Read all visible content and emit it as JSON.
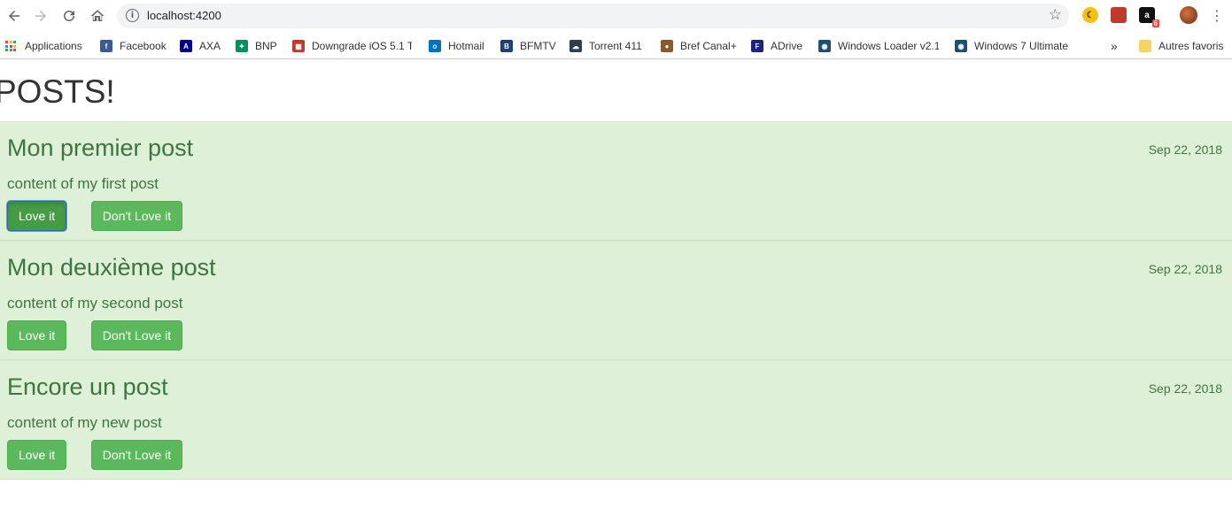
{
  "browser": {
    "url": "localhost:4200",
    "bookmarks": [
      {
        "label": "Applications",
        "icon": "apps-grid-icon"
      },
      {
        "label": "Facebook",
        "icon": "facebook-icon",
        "color": "#3b5998"
      },
      {
        "label": "AXA",
        "icon": "axa-icon",
        "color": "#00008f"
      },
      {
        "label": "BNP",
        "icon": "bnp-icon",
        "color": "#00915a"
      },
      {
        "label": "Downgrade iOS 5.1 T",
        "icon": "brick-icon",
        "color": "#c0392b"
      },
      {
        "label": "Hotmail",
        "icon": "outlook-icon",
        "color": "#0072c6"
      },
      {
        "label": "BFMTV",
        "icon": "bfmtv-icon",
        "color": "#1d3f75"
      },
      {
        "label": "Torrent 411",
        "icon": "torrent-icon",
        "color": "#2c3e50"
      },
      {
        "label": "Bref Canal+",
        "icon": "bref-icon",
        "color": "#8b5a2b"
      },
      {
        "label": "ADrive",
        "icon": "adrive-icon",
        "color": "#1a237e"
      },
      {
        "label": "Windows Loader v2.1",
        "icon": "loader-icon",
        "color": "#1f4e79"
      },
      {
        "label": "Windows 7 Ultimate",
        "icon": "loader-icon",
        "color": "#1f4e79"
      },
      {
        "label": "Autres favoris",
        "icon": "folder-icon",
        "color": "#f6d365"
      }
    ],
    "more_label": "»",
    "extension_badge": "6"
  },
  "page": {
    "title": "POSTS!",
    "posts": [
      {
        "title": "Mon premier post",
        "date": "Sep 22, 2018",
        "content": "content of my first post",
        "love_label": "Love it",
        "dont_love_label": "Don't Love it",
        "love_active": true
      },
      {
        "title": "Mon deuxième post",
        "date": "Sep 22, 2018",
        "content": "content of my second post",
        "love_label": "Love it",
        "dont_love_label": "Don't Love it",
        "love_active": false
      },
      {
        "title": "Encore un post",
        "date": "Sep 22, 2018",
        "content": "content of my new post",
        "love_label": "Love it",
        "dont_love_label": "Don't Love it",
        "love_active": false
      }
    ]
  },
  "colors": {
    "post_background": "#dff0d8",
    "post_text": "#3c763d",
    "button_success": "#5cb85c"
  }
}
